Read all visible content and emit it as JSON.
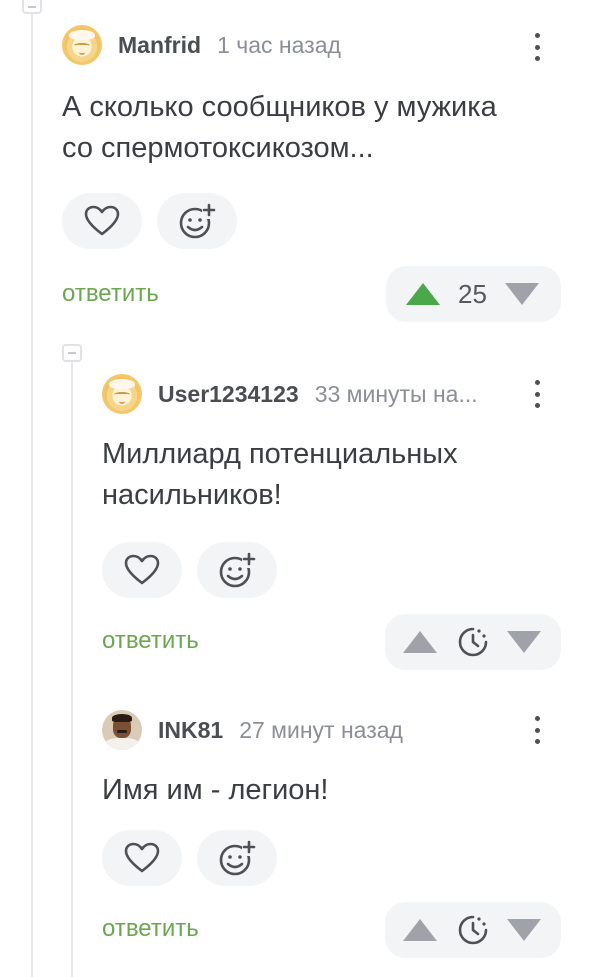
{
  "colors": {
    "accent_green": "#6aa84f",
    "upvote_active": "#4aa84b",
    "icon_grey": "#9fa3a9",
    "pill_bg": "#f2f4f6",
    "thread_line": "#e6e8eb"
  },
  "comments": [
    {
      "username": "Manfrid",
      "timestamp": "1 час назад",
      "avatar": "default-avatar",
      "text_lines": [
        "А сколько сообщников у мужика",
        "со спермотоксикозом..."
      ],
      "reply_label": "ответить",
      "score": "25",
      "upvoted": true,
      "icons": {
        "like": "heart-icon",
        "react": "add-reaction-icon",
        "menu": "more-vertical-icon"
      }
    },
    {
      "username": "User1234123",
      "timestamp": "33 минуты на...",
      "avatar": "default-avatar",
      "text_lines": [
        "Миллиард потенциальных",
        "насильников!"
      ],
      "reply_label": "ответить",
      "score_icon": "clock-pending-icon",
      "upvoted": false
    },
    {
      "username": "INK81",
      "timestamp": "27 минут назад",
      "avatar": "user-photo",
      "text_lines": [
        "Имя им - легион!"
      ],
      "reply_label": "ответить",
      "score_icon": "clock-pending-icon",
      "upvoted": false
    }
  ]
}
